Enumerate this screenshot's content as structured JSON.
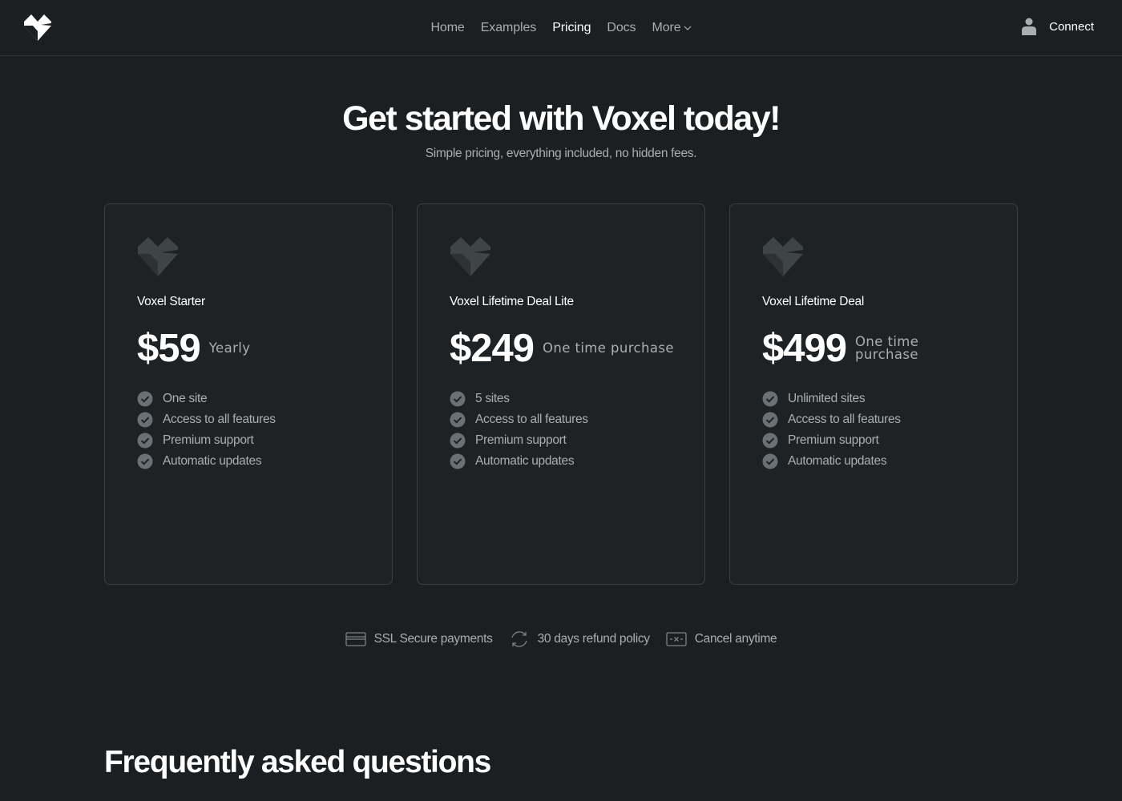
{
  "header": {
    "logo_icon": "voxel-logo-icon",
    "nav": [
      {
        "label": "Home",
        "active": false
      },
      {
        "label": "Examples",
        "active": false
      },
      {
        "label": "Pricing",
        "active": true
      },
      {
        "label": "Docs",
        "active": false
      },
      {
        "label": "More",
        "active": false,
        "has_dropdown": true
      }
    ],
    "connect_label": "Connect",
    "connect_icon": "user-icon"
  },
  "hero": {
    "title": "Get started with Voxel today!",
    "subtitle": "Simple pricing, everything included, no hidden fees."
  },
  "plans": [
    {
      "name": "Voxel Starter",
      "price": "$59",
      "period": "Yearly",
      "features": [
        "One site",
        "Access to all features",
        "Premium support",
        "Automatic updates"
      ]
    },
    {
      "name": "Voxel Lifetime Deal Lite",
      "price": "$249",
      "period": "One time purchase",
      "features": [
        "5 sites",
        "Access to all features",
        "Premium support",
        "Automatic updates"
      ]
    },
    {
      "name": "Voxel Lifetime Deal",
      "price": "$499",
      "period": "One time purchase",
      "features": [
        "Unlimited sites",
        "Access to all features",
        "Premium support",
        "Automatic updates"
      ]
    }
  ],
  "trust": [
    {
      "label": "SSL Secure payments",
      "icon": "credit-card-icon"
    },
    {
      "label": "30 days refund policy",
      "icon": "refresh-icon"
    },
    {
      "label": "Cancel anytime",
      "icon": "cancel-box-icon"
    }
  ],
  "faq": {
    "title": "Frequently asked questions"
  },
  "colors": {
    "background": "#1b1f21",
    "card_background": "#1e2225",
    "border": "#3a3f42",
    "text_primary": "#ffffff",
    "text_secondary": "#a9aeb1",
    "check_fill": "#6a7074"
  }
}
